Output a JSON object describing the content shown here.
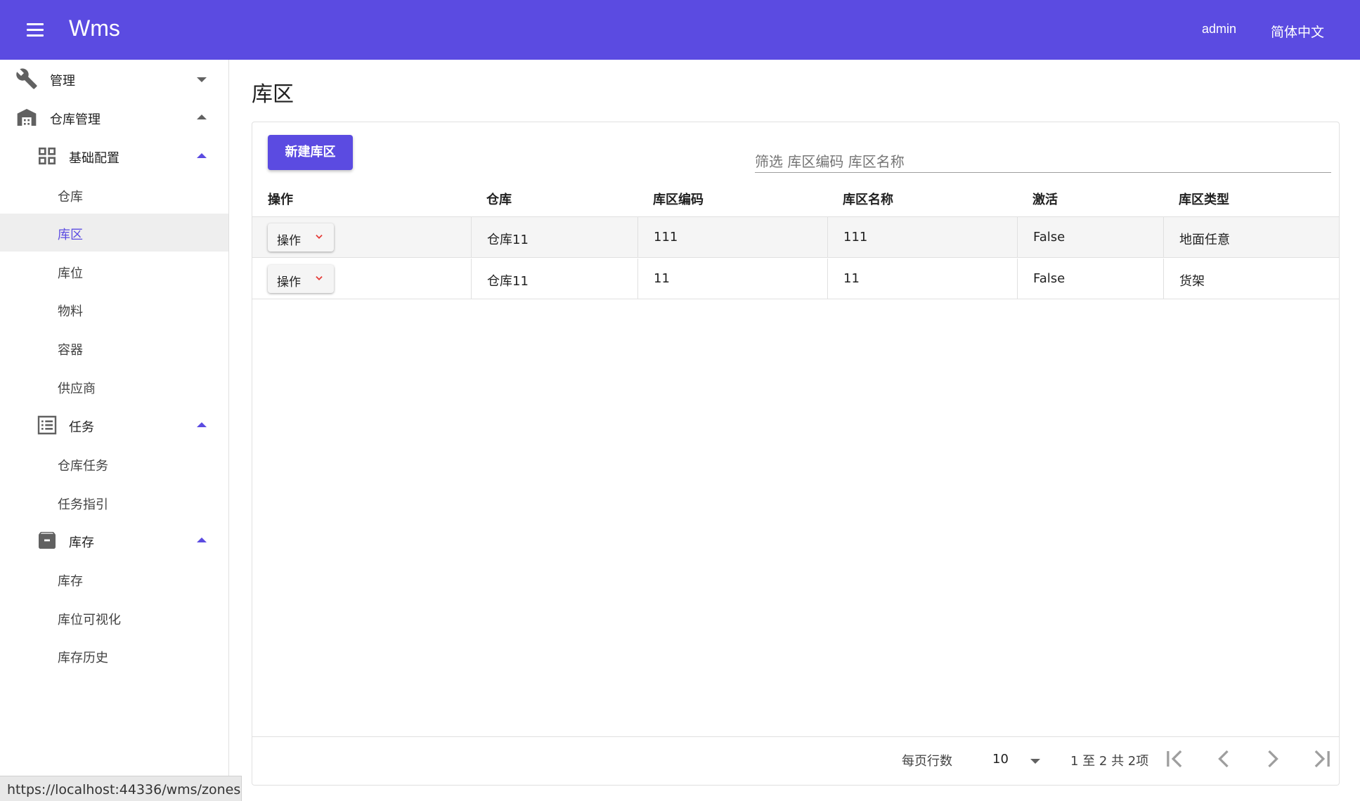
{
  "app": {
    "title": "Wms",
    "user": "admin",
    "language": "简体中文"
  },
  "sidebar": {
    "groups": [
      {
        "label": "管理",
        "icon": "wrench-icon"
      },
      {
        "label": "仓库管理",
        "icon": "warehouse-icon"
      }
    ],
    "subgroups": [
      {
        "label": "基础配置",
        "icon": "grid-icon"
      },
      {
        "label": "任务",
        "icon": "list-icon"
      },
      {
        "label": "库存",
        "icon": "archive-icon"
      }
    ],
    "items": [
      "仓库",
      "库区",
      "库位",
      "物料",
      "容器",
      "供应商",
      "仓库任务",
      "任务指引",
      "库存",
      "库位可视化",
      "库存历史"
    ],
    "active_item": "库区"
  },
  "page": {
    "title": "库区"
  },
  "toolbar": {
    "new_label": "新建库区",
    "search_placeholder": "筛选 库区编码 库区名称"
  },
  "table": {
    "columns": [
      "操作",
      "仓库",
      "库区编码",
      "库区名称",
      "激活",
      "库区类型"
    ],
    "action_label": "操作",
    "rows": [
      {
        "warehouse": "仓库11",
        "code": "111",
        "name": "111",
        "active": "False",
        "type": "地面任意"
      },
      {
        "warehouse": "仓库11",
        "code": "11",
        "name": "11",
        "active": "False",
        "type": "货架"
      }
    ]
  },
  "pagination": {
    "rows_per_page_label": "每页行数",
    "rows_per_page": "10",
    "range_text": "1 至 2 共 2项"
  },
  "status_url": "https://localhost:44336/wms/zones",
  "colors": {
    "primary": "#5b4be1",
    "accent": "#e53935"
  }
}
